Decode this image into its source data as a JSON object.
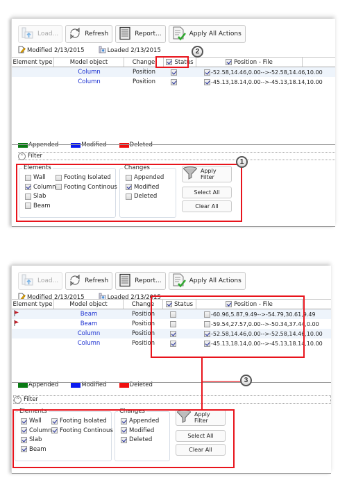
{
  "colors": {
    "accent_red": "#e8141c",
    "link_blue": "#1a2fd0",
    "appended": "#0a7a14",
    "modified": "#0a1af0",
    "deleted": "#f01010"
  },
  "toolbar": {
    "load_label": "Load...",
    "refresh_label": "Refresh",
    "report_label": "Report...",
    "apply_all_label": "Apply All Actions"
  },
  "info": {
    "modified": "Modified 2/13/2015",
    "loaded": "Loaded 2/13/2015"
  },
  "grid": {
    "columns": [
      "Element type",
      "Model object",
      "Change",
      "Status",
      "Position - File"
    ]
  },
  "legend": {
    "appended": "Appended",
    "modified": "Modified",
    "deleted": "Deleted"
  },
  "filter": {
    "label": "Filter",
    "elements_title": "Elements",
    "changes_title": "Changes",
    "element_options": [
      "Wall",
      "Column",
      "Slab",
      "Beam",
      "Footing Isolated",
      "Footing Continous"
    ],
    "change_options": [
      "Appended",
      "Modified",
      "Deleted"
    ],
    "apply_filter_label": "Apply Filter",
    "select_all_label": "Select All",
    "clear_all_label": "Clear All"
  },
  "panel1": {
    "callouts": {
      "status_header": "2",
      "filter_box": "1"
    },
    "status_header_checked": true,
    "position_header_checked": true,
    "rows": [
      {
        "element_type": "",
        "flag": false,
        "model_object": "Column",
        "change": "Position",
        "status": true,
        "position_checked": true,
        "position": "-52.58,14.46,0.00-->-52.58,14.46,10.00"
      },
      {
        "element_type": "",
        "flag": false,
        "model_object": "Column",
        "change": "Position",
        "status": true,
        "position_checked": true,
        "position": "-45.13,18.14,0.00-->-45.13,18.14,10.00"
      }
    ],
    "elements_checked": {
      "Wall": false,
      "Column": true,
      "Slab": false,
      "Beam": false,
      "Footing Isolated": false,
      "Footing Continous": false
    },
    "changes_checked": {
      "Appended": false,
      "Modified": true,
      "Deleted": false
    }
  },
  "panel2": {
    "callouts": {
      "link": "3"
    },
    "status_header_checked": true,
    "position_header_checked": true,
    "rows": [
      {
        "element_type": "",
        "flag": true,
        "model_object": "Beam",
        "change": "Position",
        "status": false,
        "position_checked": false,
        "position": "-60.96,5.87,9.49-->-54.79,30.61,9.49"
      },
      {
        "element_type": "",
        "flag": true,
        "model_object": "Beam",
        "change": "Position",
        "status": false,
        "position_checked": false,
        "position": "-59.54,27.57,0.00-->-50.34,37.44,0.00"
      },
      {
        "element_type": "",
        "flag": false,
        "model_object": "Column",
        "change": "Position",
        "status": true,
        "position_checked": true,
        "position": "-52.58,14.46,0.00-->-52.58,14.46,10.00"
      },
      {
        "element_type": "",
        "flag": false,
        "model_object": "Column",
        "change": "Position",
        "status": true,
        "position_checked": true,
        "position": "-45.13,18.14,0.00-->-45.13,18.14,10.00"
      }
    ],
    "elements_checked": {
      "Wall": true,
      "Column": true,
      "Slab": true,
      "Beam": true,
      "Footing Isolated": true,
      "Footing Continous": true
    },
    "changes_checked": {
      "Appended": true,
      "Modified": true,
      "Deleted": true
    }
  }
}
